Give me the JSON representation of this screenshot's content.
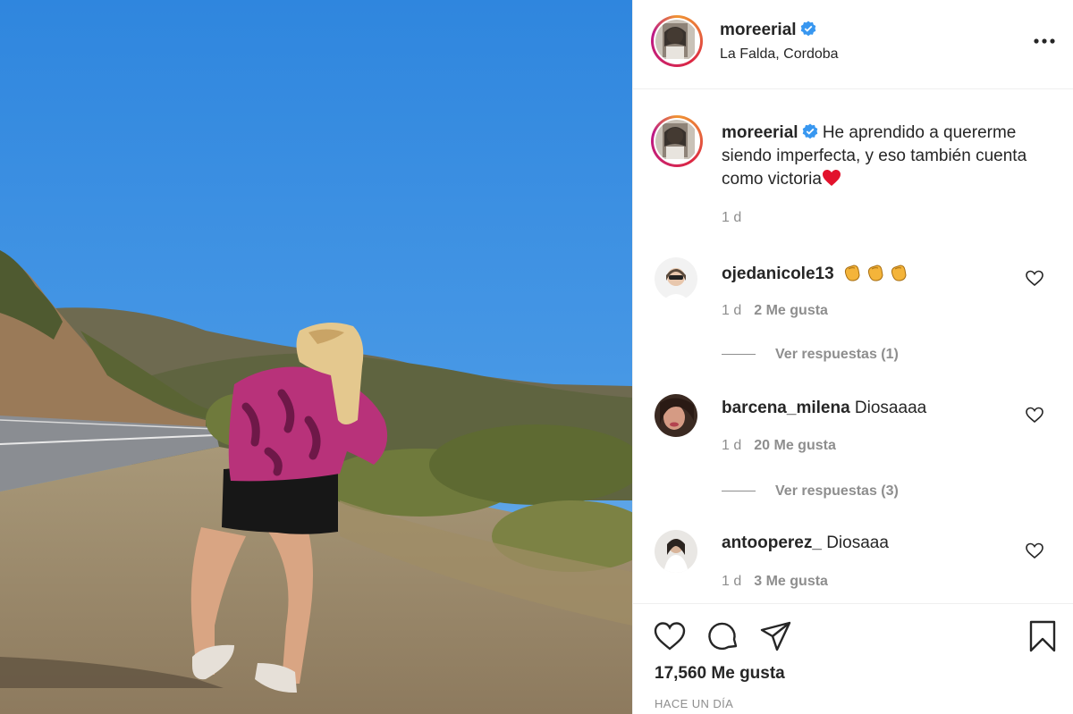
{
  "post": {
    "author": {
      "username": "moreerial",
      "verified": true,
      "location": "La Falda, Cordoba"
    },
    "caption": {
      "username": "moreerial",
      "text": "He aprendido a quererme siendo imperfecta, y eso también cuenta como victoria",
      "emoji": "heart",
      "age": "1 d"
    },
    "comments": [
      {
        "username": "ojedanicole13",
        "text": "",
        "emoji": "clapping-hands x3",
        "age": "1 d",
        "likes": "2 Me gusta",
        "replies": "Ver respuestas (1)"
      },
      {
        "username": "barcena_milena",
        "text": "Diosaaaa",
        "age": "1 d",
        "likes": "20 Me gusta",
        "replies": "Ver respuestas (3)"
      },
      {
        "username": "antooperez_",
        "text": "Diosaaa",
        "age": "1 d",
        "likes": "3 Me gusta"
      }
    ],
    "likes_count": "17,560 Me gusta",
    "posted": "HACE UN DÍA"
  },
  "icons": {
    "more": "more-options-icon",
    "like": "heart-icon",
    "comment": "comment-bubble-icon",
    "share": "paper-plane-icon",
    "save": "bookmark-icon",
    "verified": "verified-badge-icon"
  },
  "colors": {
    "text": "#262626",
    "secondary": "#8e8e8e",
    "verified": "#3897f0",
    "heart": "#ed4956",
    "divider": "#efefef"
  }
}
